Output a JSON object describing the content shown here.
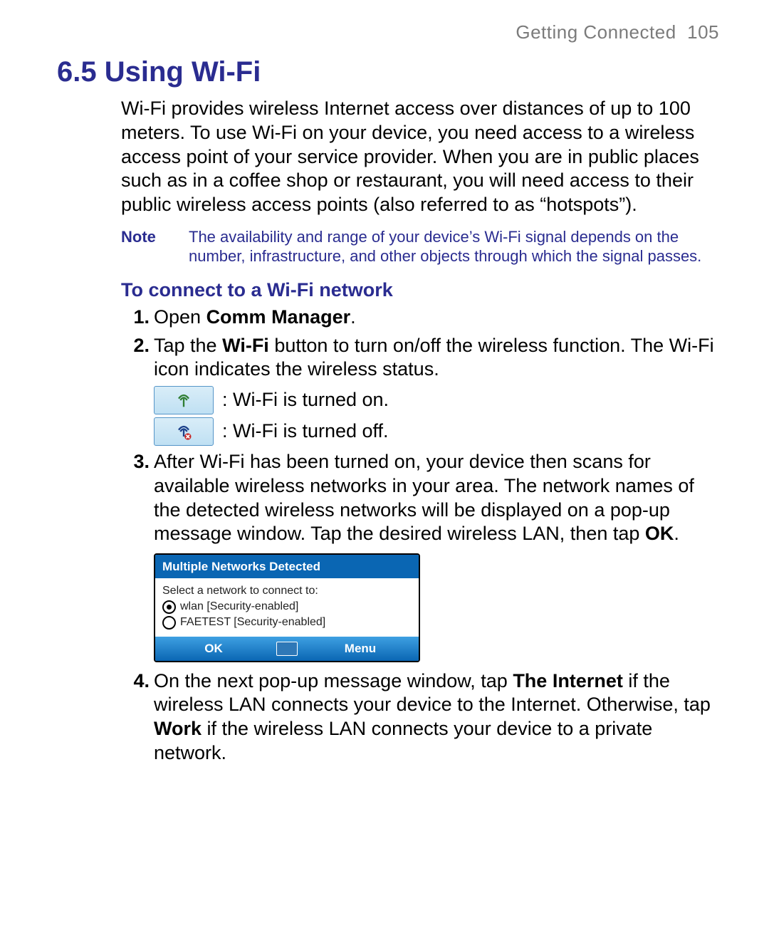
{
  "header": {
    "chapter": "Getting Connected",
    "page_number": "105"
  },
  "section": {
    "number": "6.5",
    "title": "Using Wi-Fi"
  },
  "intro": "Wi-Fi provides wireless Internet access over distances of up to 100 meters. To use Wi-Fi on your device, you need access to a wireless access point of your service provider. When you are in public places such as in a coffee shop or restaurant, you will need access to their public wireless access points (also referred to as “hotspots”).",
  "note": {
    "label": "Note",
    "body": "The availability and range of your device’s Wi-Fi signal depends on the number, infrastructure, and other objects through which the signal passes."
  },
  "subheading": "To connect to a Wi-Fi network",
  "steps": {
    "s1": {
      "marker": "1.",
      "pre": "Open ",
      "strong": "Comm Manager",
      "post": "."
    },
    "s2": {
      "marker": "2.",
      "pre": "Tap the ",
      "strong": "Wi-Fi",
      "post": " button to turn on/off the wireless function. The Wi-Fi icon indicates the wireless status.",
      "legend_on": ": Wi-Fi is turned on.",
      "legend_off": ": Wi-Fi is turned off."
    },
    "s3": {
      "marker": "3.",
      "pre": "After Wi-Fi has been turned on, your device then scans for available wireless networks in your area. The network names of the detected wireless networks will be displayed on a pop-up message window. Tap the desired wireless LAN, then tap ",
      "strong": "OK",
      "post": "."
    },
    "s4": {
      "marker": "4.",
      "p1": "On the next pop-up message window, tap ",
      "b1": "The Internet",
      "p2": " if the wireless LAN connects your device to the Internet. Otherwise, tap ",
      "b2": "Work",
      "p3": " if the wireless LAN connects your device to a private network."
    }
  },
  "popup": {
    "title": "Multiple Networks Detected",
    "prompt": "Select a network to connect to:",
    "options": {
      "o0": {
        "label": "wlan [Security-enabled]",
        "selected": true
      },
      "o1": {
        "label": "FAETEST [Security-enabled]",
        "selected": false
      }
    },
    "ok": "OK",
    "menu": "Menu"
  }
}
